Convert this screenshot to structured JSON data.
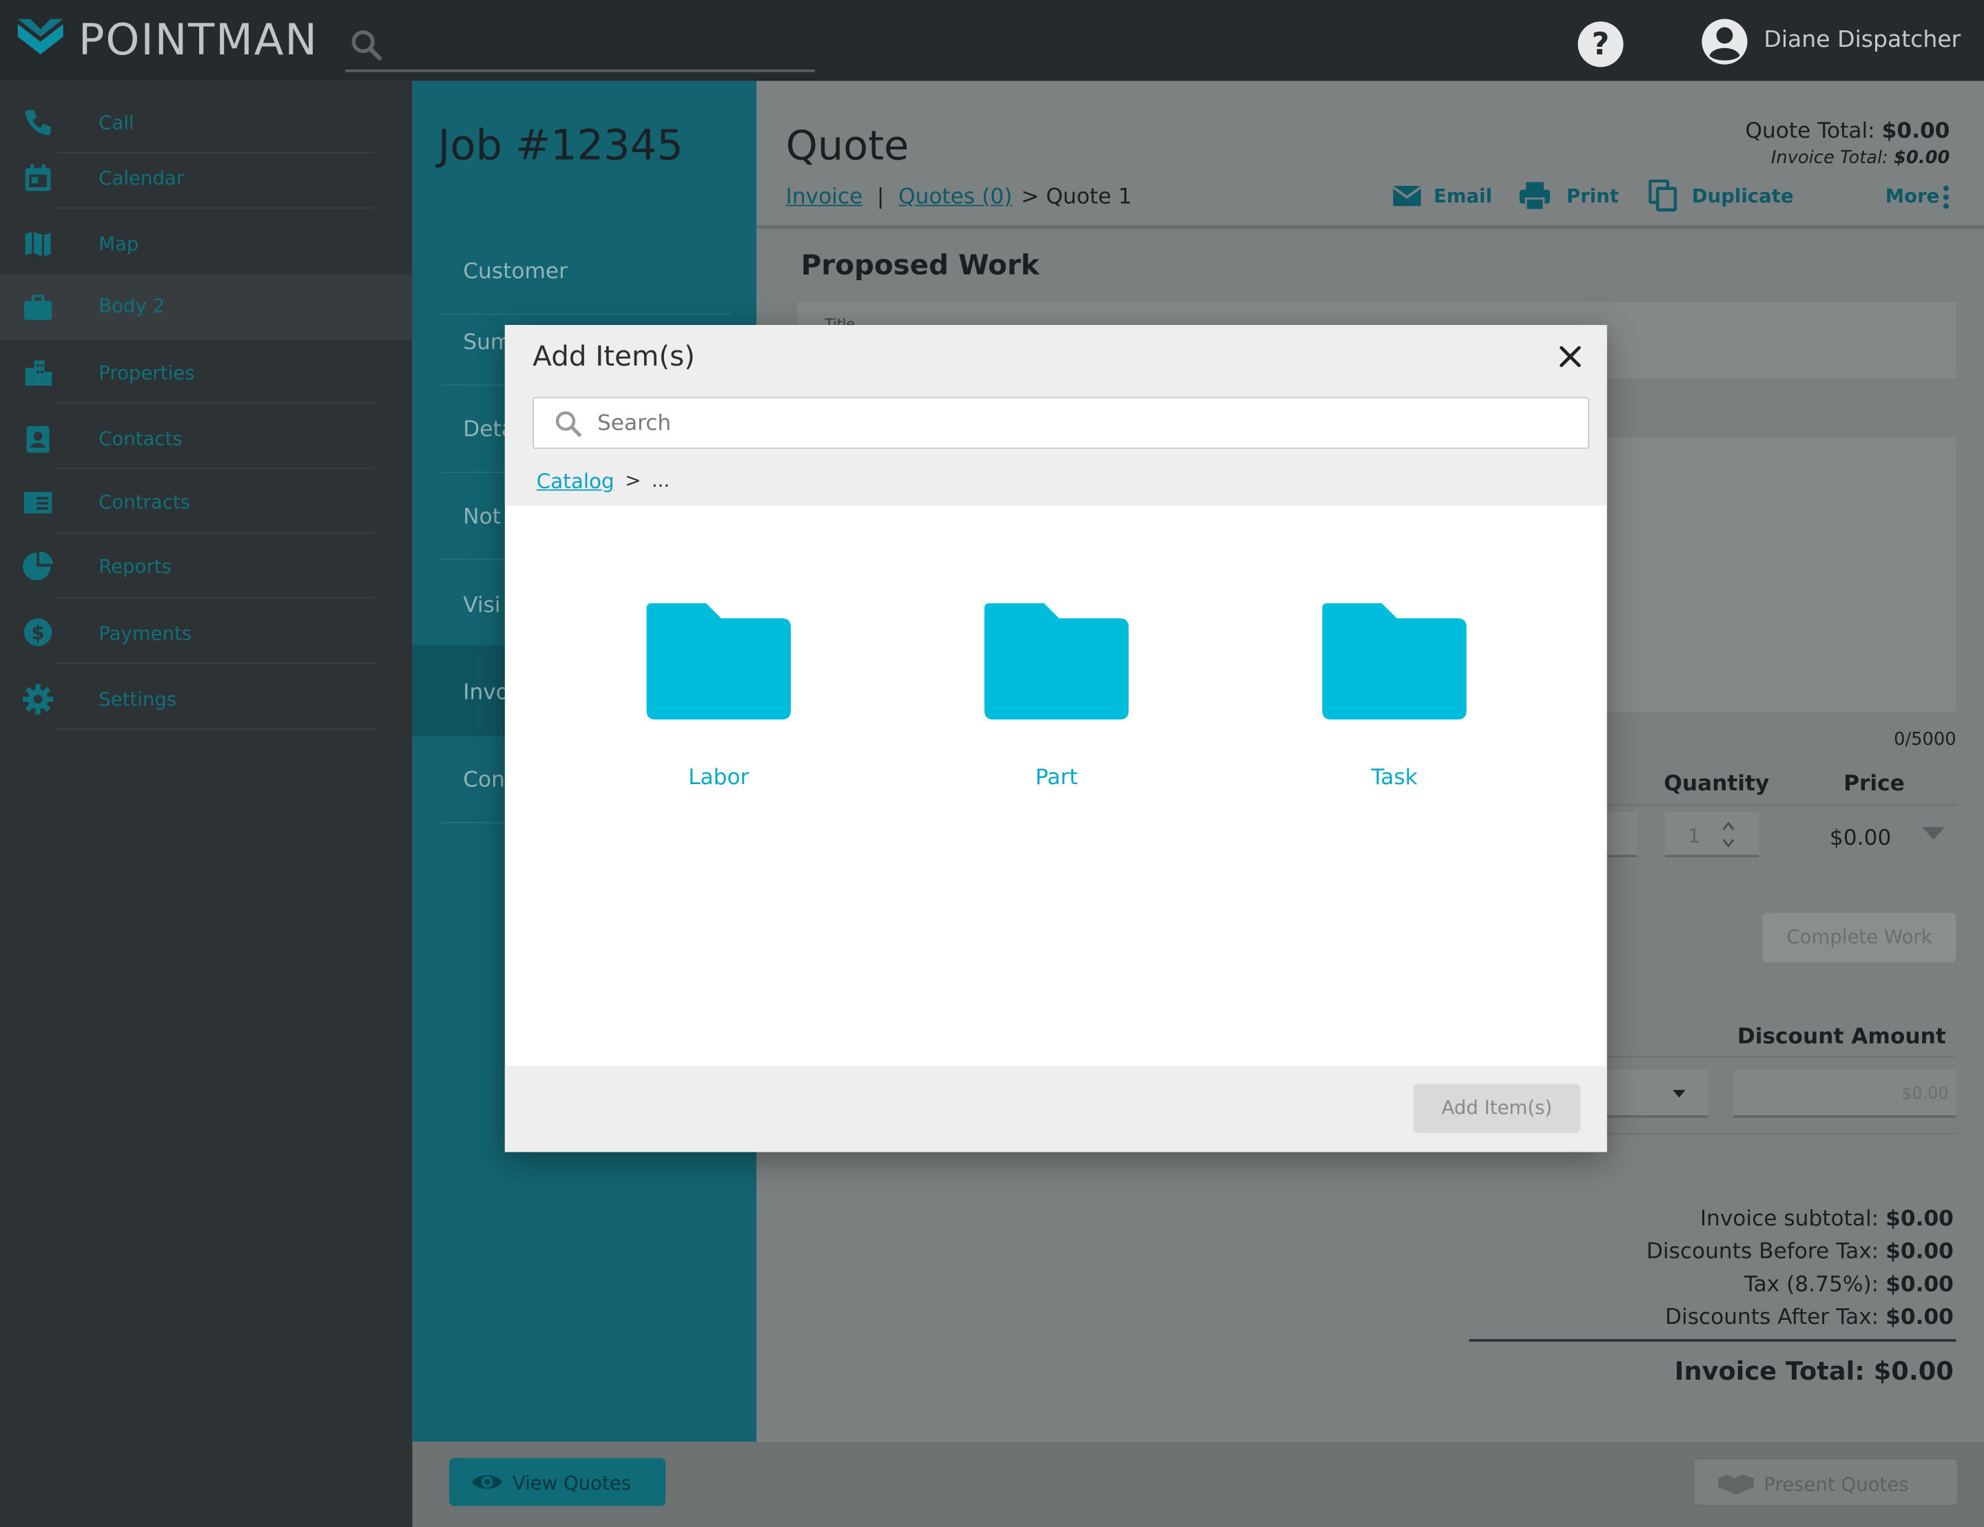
{
  "app": {
    "brand": "POINTMAN",
    "user_name": "Diane Dispatcher"
  },
  "colors": {
    "accent": "#00bcdc",
    "teal": "#136370",
    "topbar": "#252b2d"
  },
  "nav": {
    "items": [
      {
        "label": "Call",
        "icon": "phone-icon"
      },
      {
        "label": "Calendar",
        "icon": "calendar-icon"
      },
      {
        "label": "Map",
        "icon": "map-icon"
      },
      {
        "label": "Body 2",
        "icon": "briefcase-icon",
        "active": true
      },
      {
        "label": "Properties",
        "icon": "buildings-icon"
      },
      {
        "label": "Contacts",
        "icon": "contact-card-icon"
      },
      {
        "label": "Contracts",
        "icon": "contract-icon"
      },
      {
        "label": "Reports",
        "icon": "pie-chart-icon"
      },
      {
        "label": "Payments",
        "icon": "dollar-icon"
      },
      {
        "label": "Settings",
        "icon": "gear-icon"
      }
    ]
  },
  "job": {
    "title": "Job #12345",
    "tabs": [
      "Customer",
      "Sum",
      "Deta",
      "Not",
      "Visi",
      "Invo",
      "Con"
    ]
  },
  "quote": {
    "title": "Quote",
    "breadcrumb": {
      "invoice": "Invoice",
      "sep": "|",
      "quotes": "Quotes (0)",
      "current": "> Quote 1"
    },
    "quote_total_label": "Quote Total:",
    "quote_total_value": "$0.00",
    "invoice_total_label": "Invoice Total:",
    "invoice_total_value": "$0.00",
    "actions": {
      "email": "Email",
      "print": "Print",
      "duplicate": "Duplicate",
      "more": "More"
    },
    "proposed_work": "Proposed Work",
    "title_field_label": "Title",
    "char_count": "0/5000",
    "quantity_header": "Quantity",
    "price_header": "Price",
    "quantity_value": "1",
    "price_value": "$0.00",
    "complete_work": "Complete Work",
    "discount_amount_header": "Discount Amount",
    "discount_amount_placeholder": "$0.00",
    "summary": [
      {
        "label": "Invoice subtotal:",
        "value": "$0.00"
      },
      {
        "label": "Discounts Before Tax:",
        "value": "$0.00"
      },
      {
        "label": "Tax (8.75%):",
        "value": "$0.00"
      },
      {
        "label": "Discounts After Tax:",
        "value": "$0.00"
      }
    ],
    "invoice_total_final_label": "Invoice Total:",
    "invoice_total_final_value": "$0.00"
  },
  "bottom": {
    "view_quotes": "View Quotes",
    "present_quotes": "Present Quotes"
  },
  "modal": {
    "title": "Add Item(s)",
    "search_placeholder": "Search",
    "breadcrumb_root": "Catalog",
    "breadcrumb_sep": ">",
    "breadcrumb_more": "...",
    "folders": [
      "Labor",
      "Part",
      "Task"
    ],
    "add_button": "Add Item(s)"
  }
}
